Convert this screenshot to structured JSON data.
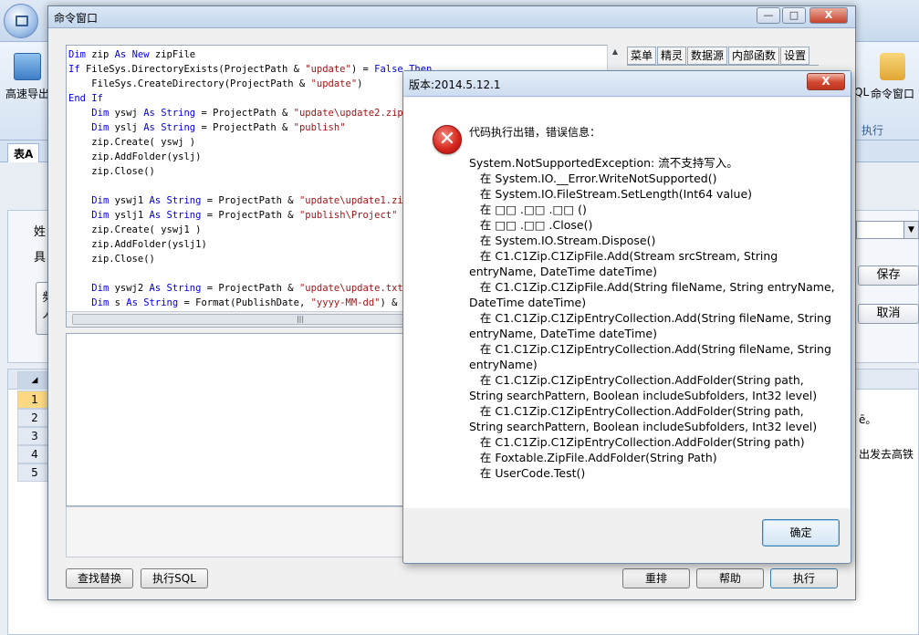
{
  "app": {
    "ribbon_left_label": "高速导出",
    "ribbon_right_sql": "QL",
    "ribbon_right_cmd": "命令窗口",
    "ribbon_group_exec": "执行",
    "sheet_tab": "表A",
    "form_label_1": "姓",
    "form_label_2": "具",
    "form_btn_left_1": "频",
    "form_btn_left_2": "人",
    "save_label": "保存",
    "cancel_label": "取消",
    "grid_rows": [
      "1",
      "2",
      "3",
      "4",
      "5"
    ],
    "grid_text_1": "ē。",
    "grid_text_2": "出发去高铁"
  },
  "cmd_window": {
    "title": "命令窗口",
    "min": "—",
    "max": "□",
    "close": "X",
    "tabs": [
      "菜单",
      "精灵",
      "数据源",
      "内部函数",
      "设置"
    ],
    "code_lines": [
      "Dim zip As New zipFile",
      "If FileSys.DirectoryExists(ProjectPath & \"update\") = False Then",
      "    FileSys.CreateDirectory(ProjectPath & \"update\")",
      "End If",
      "    Dim yswj As String = ProjectPath & \"update\\update2.zip\"",
      "    Dim yslj As String = ProjectPath & \"publish\"",
      "    zip.Create( yswj )",
      "    zip.AddFolder(yslj)",
      "    zip.Close()",
      "",
      "    Dim yswj1 As String = ProjectPath & \"update\\update1.zip\"",
      "    Dim yslj1 As String = ProjectPath & \"publish\\Project\"",
      "    zip.Create( yswj1 )",
      "    zip.AddFolder(yslj1)",
      "    zip.Close()",
      "",
      "    Dim yswj2 As String = ProjectPath & \"update\\update.txt\"",
      "    Dim s As String = Format(PublishDate, \"yyyy-MM-dd\") & \"|2"
    ],
    "buttons": {
      "find_replace": "查找替换",
      "exec_sql": "执行SQL",
      "rearrange": "重排",
      "help": "帮助",
      "execute": "执行"
    }
  },
  "dialog": {
    "title": "版本:2014.5.12.1",
    "close": "X",
    "icon": "error-icon",
    "header": "代码执行出错，错误信息：",
    "message": "System.NotSupportedException: 流不支持写入。\n   在 System.IO.__Error.WriteNotSupported()\n   在 System.IO.FileStream.SetLength(Int64 value)\n   在 □□ .□□ .□□ ()\n   在 □□ .□□ .Close()\n   在 System.IO.Stream.Dispose()\n   在 C1.C1Zip.C1ZipFile.Add(Stream srcStream, String entryName, DateTime dateTime)\n   在 C1.C1Zip.C1ZipFile.Add(String fileName, String entryName, DateTime dateTime)\n   在 C1.C1Zip.C1ZipEntryCollection.Add(String fileName, String entryName, DateTime dateTime)\n   在 C1.C1Zip.C1ZipEntryCollection.Add(String fileName, String entryName)\n   在 C1.C1Zip.C1ZipEntryCollection.AddFolder(String path, String searchPattern, Boolean includeSubfolders, Int32 level)\n   在 C1.C1Zip.C1ZipEntryCollection.AddFolder(String path, String searchPattern, Boolean includeSubfolders, Int32 level)\n   在 C1.C1Zip.C1ZipEntryCollection.AddFolder(String path)\n   在 Foxtable.ZipFile.AddFolder(String Path)\n   在 UserCode.Test()",
    "ok_label": "确定"
  }
}
